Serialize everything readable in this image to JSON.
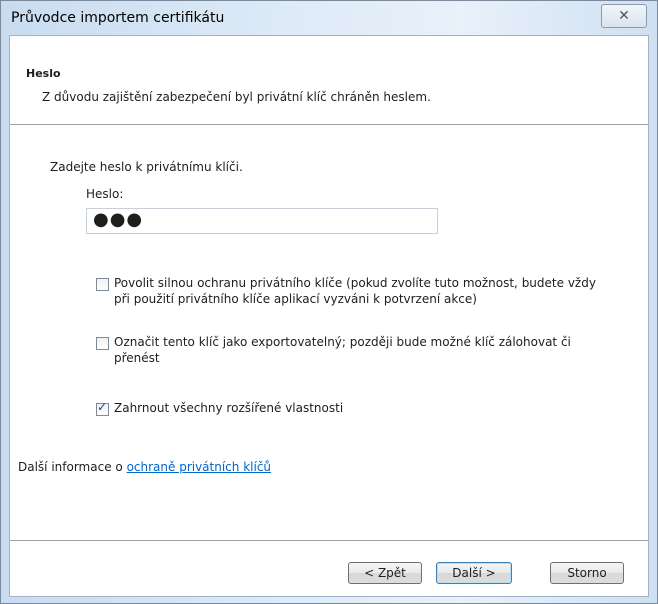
{
  "window": {
    "title": "Průvodce importem certifikátu",
    "close_label": "✕"
  },
  "header": {
    "title": "Heslo",
    "description": "Z důvodu zajištění zabezpečení byl privátní klíč chráněn heslem."
  },
  "body": {
    "prompt": "Zadejte heslo k privátnímu klíči.",
    "password_label": "Heslo:",
    "password_value": "●●●"
  },
  "options": [
    {
      "label": "Povolit silnou ochranu privátního klíče (pokud zvolíte tuto možnost, budete vždy\npři použití privátního klíče aplikací vyzváni k potvrzení akce)",
      "checked": false
    },
    {
      "label": "Označit tento klíč jako exportovatelný; později bude možné klíč zálohovat či\npřenést",
      "checked": false
    },
    {
      "label": "Zahrnout všechny rozšířené vlastnosti",
      "checked": true
    }
  ],
  "more_info": {
    "prefix": "Další informace o ",
    "link_text": "ochraně privátních klíčů"
  },
  "buttons": {
    "back": "< Zpět",
    "next": "Další >",
    "cancel": "Storno"
  }
}
